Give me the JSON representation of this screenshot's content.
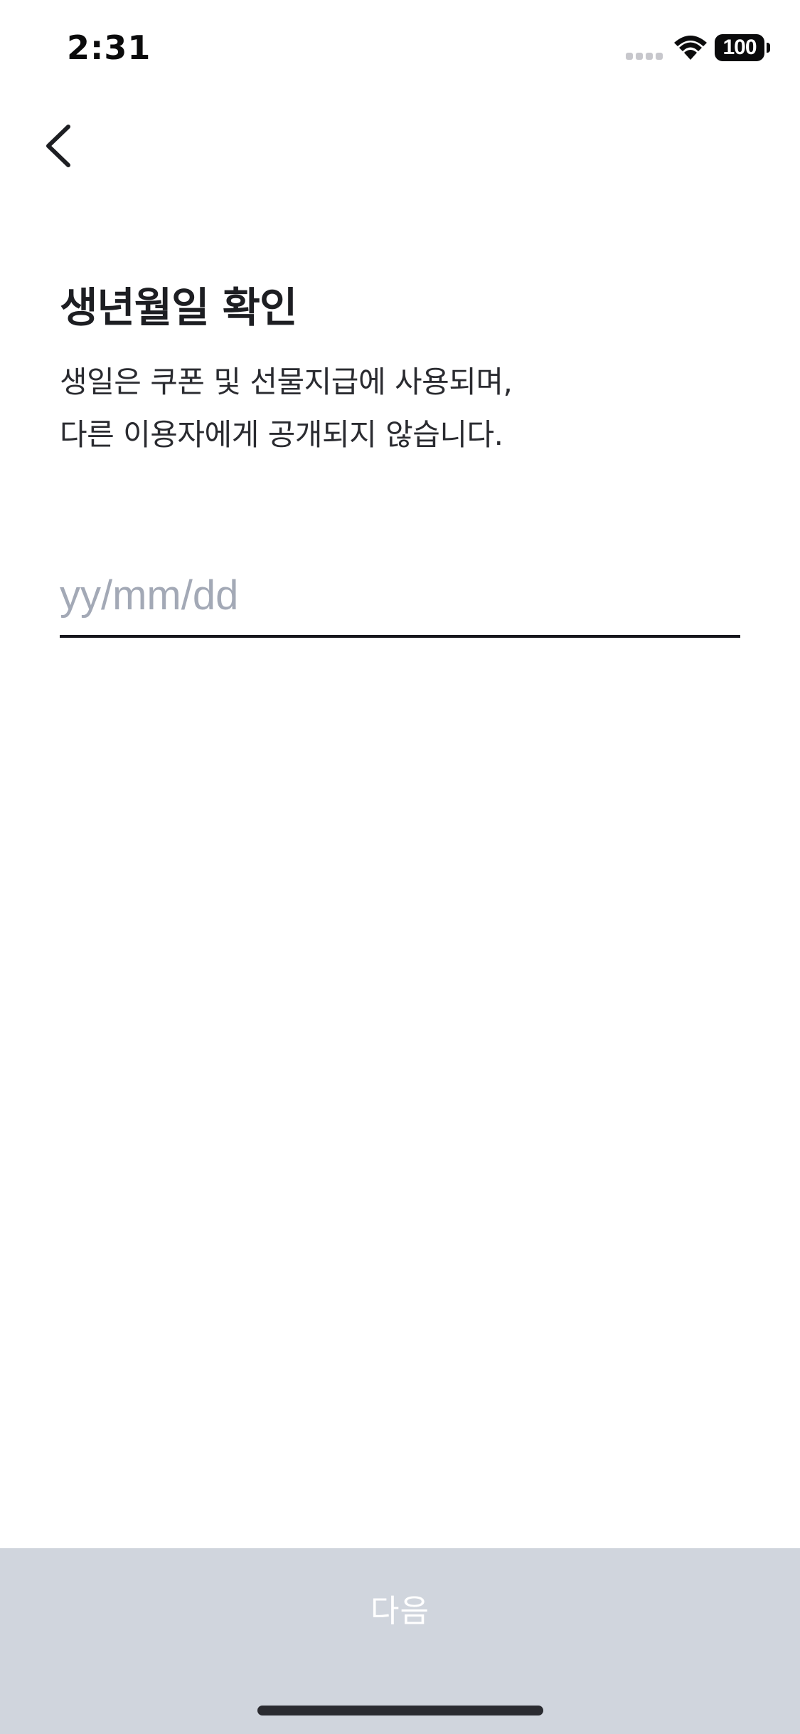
{
  "status_bar": {
    "time": "2:31",
    "battery_level": "100",
    "signal_icon": "cellular-signal-icon",
    "wifi_icon": "wifi-icon",
    "battery_icon": "battery-icon"
  },
  "nav": {
    "back_icon": "chevron-left-icon"
  },
  "page": {
    "title": "생년월일 확인",
    "description_line1": "생일은 쿠폰 및 선물지급에 사용되며,",
    "description_line2": "다른 이용자에게 공개되지 않습니다."
  },
  "birthdate_input": {
    "value": "",
    "placeholder": "yy/mm/dd"
  },
  "footer": {
    "next_label": "다음",
    "button_color": "#d0d5dd"
  }
}
